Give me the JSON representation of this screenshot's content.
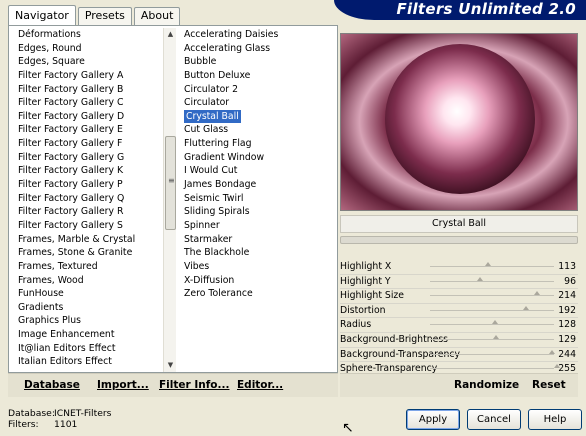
{
  "app": {
    "title": "Filters Unlimited 2.0"
  },
  "tabs": [
    "Navigator",
    "Presets",
    "About"
  ],
  "categories": [
    "Déformations",
    "Edges, Round",
    "Edges, Square",
    "Filter Factory Gallery A",
    "Filter Factory Gallery B",
    "Filter Factory Gallery C",
    "Filter Factory Gallery D",
    "Filter Factory Gallery E",
    "Filter Factory Gallery F",
    "Filter Factory Gallery G",
    "Filter Factory Gallery K",
    "Filter Factory Gallery P",
    "Filter Factory Gallery Q",
    "Filter Factory Gallery R",
    "Filter Factory Gallery S",
    "Frames, Marble & Crystal",
    "Frames, Stone & Granite",
    "Frames, Textured",
    "Frames, Wood",
    "FunHouse",
    "Gradients",
    "Graphics Plus",
    "Image Enhancement",
    "It@lian Editors Effect",
    "Italian Editors Effect"
  ],
  "filters": [
    "Accelerating Daisies",
    "Accelerating Glass",
    "Bubble",
    "Button Deluxe",
    "Circulator 2",
    "Circulator",
    "Crystal Ball",
    "Cut Glass",
    "Fluttering Flag",
    "Gradient Window",
    "I Would Cut",
    "James Bondage",
    "Seismic Twirl",
    "Sliding Spirals",
    "Spinner",
    "Starmaker",
    "The Blackhole",
    "Vibes",
    "X-Diffusion",
    "Zero Tolerance"
  ],
  "selected_filter": "Crystal Ball",
  "buttons": {
    "database": "Database",
    "import": "Import...",
    "filter_info": "Filter Info...",
    "editor": "Editor..."
  },
  "preview": {
    "filter_name": "Crystal Ball"
  },
  "parameters": [
    {
      "label": "Highlight X",
      "value": 113
    },
    {
      "label": "Highlight Y",
      "value": 96
    },
    {
      "label": "Highlight Size",
      "value": 214
    },
    {
      "label": "Distortion",
      "value": 192
    },
    {
      "label": "Radius",
      "value": 128
    },
    {
      "label": "Background-Brightness",
      "value": 129
    },
    {
      "label": "Background-Transparency",
      "value": 244
    },
    {
      "label": "Sphere-Transparency",
      "value": 255
    }
  ],
  "right_buttons": {
    "randomize": "Randomize",
    "reset": "Reset"
  },
  "status": {
    "database_label": "Database:",
    "database_value": "ICNET-Filters",
    "filters_label": "Filters:",
    "filters_value": "1101"
  },
  "dialog": {
    "apply": "Apply",
    "cancel": "Cancel",
    "help": "Help"
  },
  "colors": {
    "banner": "#001a6e",
    "selection": "#316ac5"
  }
}
